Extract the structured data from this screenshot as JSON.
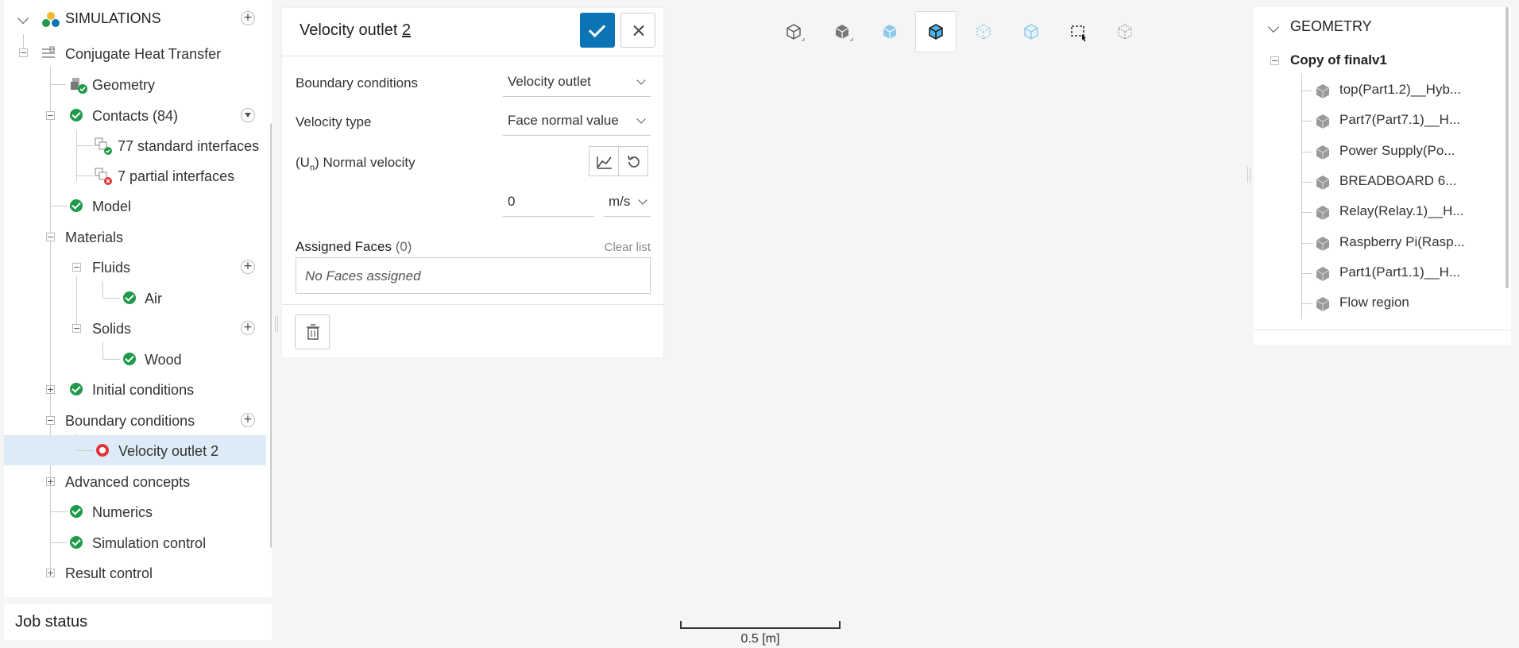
{
  "tree": {
    "simulations_label": "SIMULATIONS",
    "project_label": "Conjugate Heat Transfer",
    "geometry_label": "Geometry",
    "contacts_label": "Contacts (84)",
    "standard_interfaces_label": "77 standard interfaces",
    "partial_interfaces_label": "7 partial interfaces",
    "model_label": "Model",
    "materials_label": "Materials",
    "fluids_label": "Fluids",
    "air_label": "Air",
    "solids_label": "Solids",
    "wood_label": "Wood",
    "initial_conditions_label": "Initial conditions",
    "boundary_conditions_label": "Boundary conditions",
    "velocity_outlet_label": "Velocity outlet 2",
    "advanced_concepts_label": "Advanced concepts",
    "numerics_label": "Numerics",
    "simulation_control_label": "Simulation control",
    "result_control_label": "Result control"
  },
  "job_status": {
    "label": "Job status"
  },
  "bc_panel": {
    "title_main": "Velocity outlet ",
    "title_suffix": "2",
    "boundary_conditions_label": "Boundary conditions",
    "boundary_conditions_value": "Velocity outlet",
    "velocity_type_label": "Velocity type",
    "velocity_type_value": "Face normal value",
    "normal_velocity_prefix": "(U",
    "normal_velocity_sub": "n",
    "normal_velocity_rest": ") Normal velocity",
    "velocity_value": "0",
    "velocity_unit": "m/s",
    "assigned_faces_label": "Assigned Faces",
    "assigned_faces_count": "(0)",
    "clear_list_label": "Clear list",
    "no_faces_text": "No Faces assigned"
  },
  "geometry_panel": {
    "header": "GEOMETRY",
    "root_label": "Copy of finalv1",
    "items": [
      "top(Part1.2)__Hyb...",
      "Part7(Part7.1)__H...",
      "Power Supply(Po...",
      "BREADBOARD 6...",
      "Relay(Relay.1)__H...",
      "Raspberry Pi(Rasp...",
      "Part1(Part1.1)__H...",
      "Flow region"
    ]
  },
  "scale": {
    "label": "0.5 [m]"
  },
  "colors": {
    "accent": "#0b74b4",
    "success": "#1e9a4a",
    "error": "#e0323b",
    "selected_row": "#dcebf5"
  }
}
